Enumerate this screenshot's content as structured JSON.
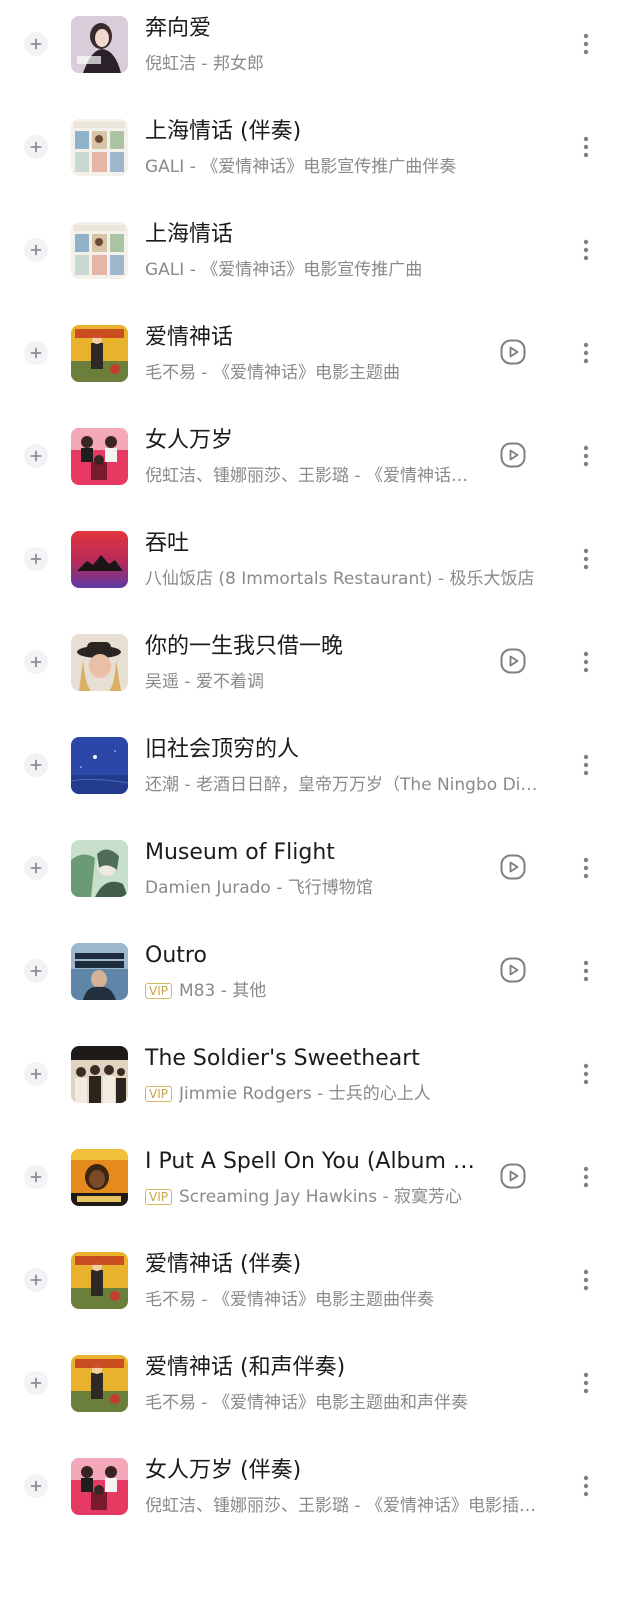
{
  "songs": [
    {
      "title": "奔向爱",
      "subtitle": "倪虹洁 - 邦女郎",
      "vip": "",
      "has_mv": false,
      "cover": "woman-portrait"
    },
    {
      "title": "上海情话 (伴奏)",
      "subtitle": "GALI - 《爱情神话》电影宣传推广曲伴奏",
      "vip": "",
      "has_mv": false,
      "cover": "shanghai-collage"
    },
    {
      "title": "上海情话",
      "subtitle": "GALI - 《爱情神话》电影宣传推广曲",
      "vip": "",
      "has_mv": false,
      "cover": "shanghai-collage"
    },
    {
      "title": "爱情神话",
      "subtitle": "毛不易 - 《爱情神话》电影主题曲",
      "vip": "",
      "has_mv": true,
      "cover": "love-myth-yellow"
    },
    {
      "title": "女人万岁",
      "subtitle": "倪虹洁、锺娜丽莎、王影璐 - 《爱情神话》电影插曲",
      "vip": "",
      "has_mv": true,
      "cover": "women-red"
    },
    {
      "title": "吞吐",
      "subtitle": "八仙饭店 (8 Immortals Restaurant) - 极乐大饭店",
      "vip": "",
      "has_mv": false,
      "cover": "mountain-sunset"
    },
    {
      "title": "你的一生我只借一晚",
      "subtitle": "吴遥 - 爱不着调",
      "vip": "",
      "has_mv": true,
      "cover": "hat-portrait"
    },
    {
      "title": "旧社会顶穷的人",
      "subtitle": "还潮 - 老酒日日醉，皇帝万万岁（The Ningbo Dialect）",
      "vip": "",
      "has_mv": false,
      "cover": "night-sky"
    },
    {
      "title": "Museum of Flight",
      "subtitle": "Damien Jurado - 飞行博物馆",
      "vip": "",
      "has_mv": true,
      "cover": "green-portrait"
    },
    {
      "title": "Outro",
      "subtitle": "M83 - 其他",
      "vip": "VIP",
      "has_mv": true,
      "cover": "gambler-poster"
    },
    {
      "title": "The Soldier's Sweetheart",
      "subtitle": "Jimmie Rodgers - 士兵的心上人",
      "vip": "VIP",
      "has_mv": false,
      "cover": "band-photo"
    },
    {
      "title": "I Put A Spell On You (Album Version)",
      "subtitle": "Screaming Jay Hawkins - 寂寞芳心",
      "vip": "VIP",
      "has_mv": true,
      "cover": "spell-poster"
    },
    {
      "title": "爱情神话 (伴奏)",
      "subtitle": "毛不易 - 《爱情神话》电影主题曲伴奏",
      "vip": "",
      "has_mv": false,
      "cover": "love-myth-yellow"
    },
    {
      "title": "爱情神话 (和声伴奏)",
      "subtitle": "毛不易 - 《爱情神话》电影主题曲和声伴奏",
      "vip": "",
      "has_mv": false,
      "cover": "love-myth-yellow"
    },
    {
      "title": "女人万岁 (伴奏)",
      "subtitle": "倪虹洁、锺娜丽莎、王影璐 - 《爱情神话》电影插曲伴奏",
      "vip": "",
      "has_mv": false,
      "cover": "women-red"
    }
  ],
  "icons": {
    "add": "plus-icon",
    "mv": "play-video-icon",
    "more": "more-vertical-icon"
  },
  "colors": {
    "title": "#1b1b1b",
    "subtitle": "#8a8a8e",
    "vip": "#c9a24a",
    "icon": "#7d7f86"
  }
}
